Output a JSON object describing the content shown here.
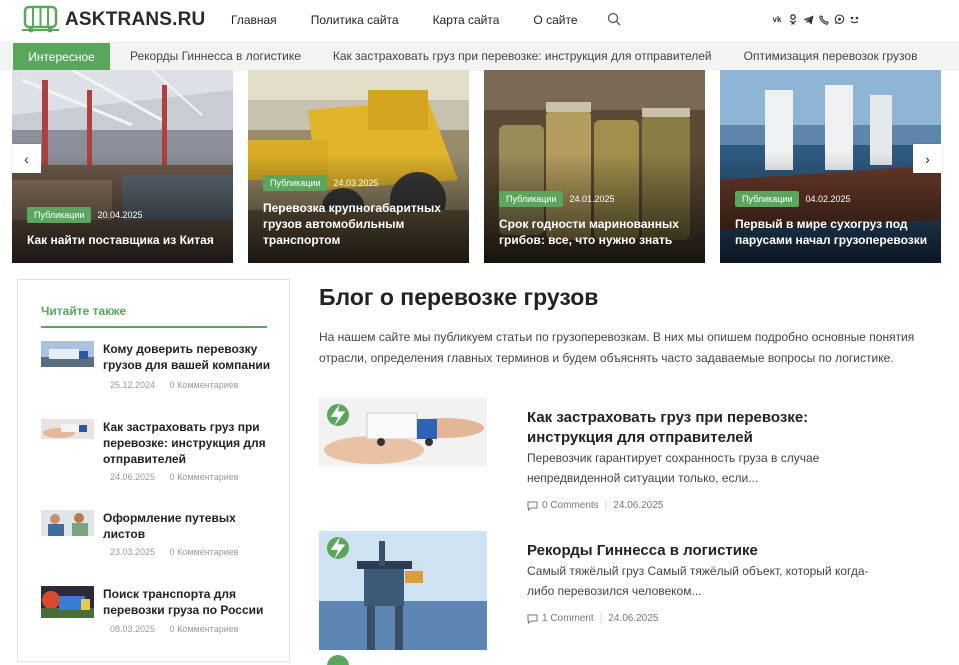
{
  "header": {
    "logo_text": "ASKTRANS.RU",
    "nav": [
      "Главная",
      "Политика сайта",
      "Карта сайта",
      "О сайте"
    ],
    "socials": [
      "vk-icon",
      "odnoklassniki-icon",
      "telegram-icon",
      "viber-icon",
      "whatsapp-icon",
      "yandex-zen-icon"
    ]
  },
  "ticker": {
    "label": "Интересное",
    "items": [
      "Рекорды Гиннесса в логистике",
      "Как застраховать груз при перевозке: инструкция для отправителей",
      "Оптимизация перевозок грузов"
    ]
  },
  "slider": [
    {
      "badge": "Публикации",
      "date": "20.04.2025",
      "title": "Как найти поставщика из Китая"
    },
    {
      "badge": "Публикации",
      "date": "24.03.2025",
      "title": "Перевозка крупногабаритных грузов автомобильным транспортом"
    },
    {
      "badge": "Публикации",
      "date": "24.01.2025",
      "title": "Срок годности маринованных грибов: все, что нужно знать"
    },
    {
      "badge": "Публикации",
      "date": "04.02.2025",
      "title": "Первый в мире сухогруз под парусами начал грузоперевозки"
    }
  ],
  "arrows": {
    "prev": "‹",
    "next": "›"
  },
  "sidebar": {
    "title": "Читайте также",
    "items": [
      {
        "title": "Кому доверить перевозку грузов для вашей компании",
        "date": "25.12.2024",
        "comments": "0 Комментариев"
      },
      {
        "title": "Как застраховать груз при перевозке: инструкция для отправителей",
        "date": "24.06.2025",
        "comments": "0 Комментариев"
      },
      {
        "title": "Оформление путевых листов",
        "date": "23.03.2025",
        "comments": "0 Комментариев"
      },
      {
        "title": "Поиск транспорта для перевозки груза по России",
        "date": "08.03.2025",
        "comments": "0 Комментариев"
      }
    ]
  },
  "main": {
    "title": "Блог о перевозке грузов",
    "intro": "На нашем сайте мы публикуем статьи по грузоперевозкам. В них мы опишем подробно основные понятия отрасли, определения главных терминов и будем объяснять часто задаваемые вопросы по логистике.",
    "posts": [
      {
        "title": "Как застраховать груз при перевозке: инструкция для отправителей",
        "excerpt": "Перевозчик гарантирует сохранность груза в случае непредвиденной ситуации только, если...",
        "comments": "0 Comments",
        "date": "24.06.2025"
      },
      {
        "title": "Рекорды Гиннесса в логистике",
        "excerpt": "Самый тяжёлый груз Самый тяжёлый объект, который когда-либо перевозился человеком...",
        "comments": "1 Comment",
        "date": "24.06.2025"
      }
    ]
  },
  "colors": {
    "accent": "#5aa65d"
  }
}
